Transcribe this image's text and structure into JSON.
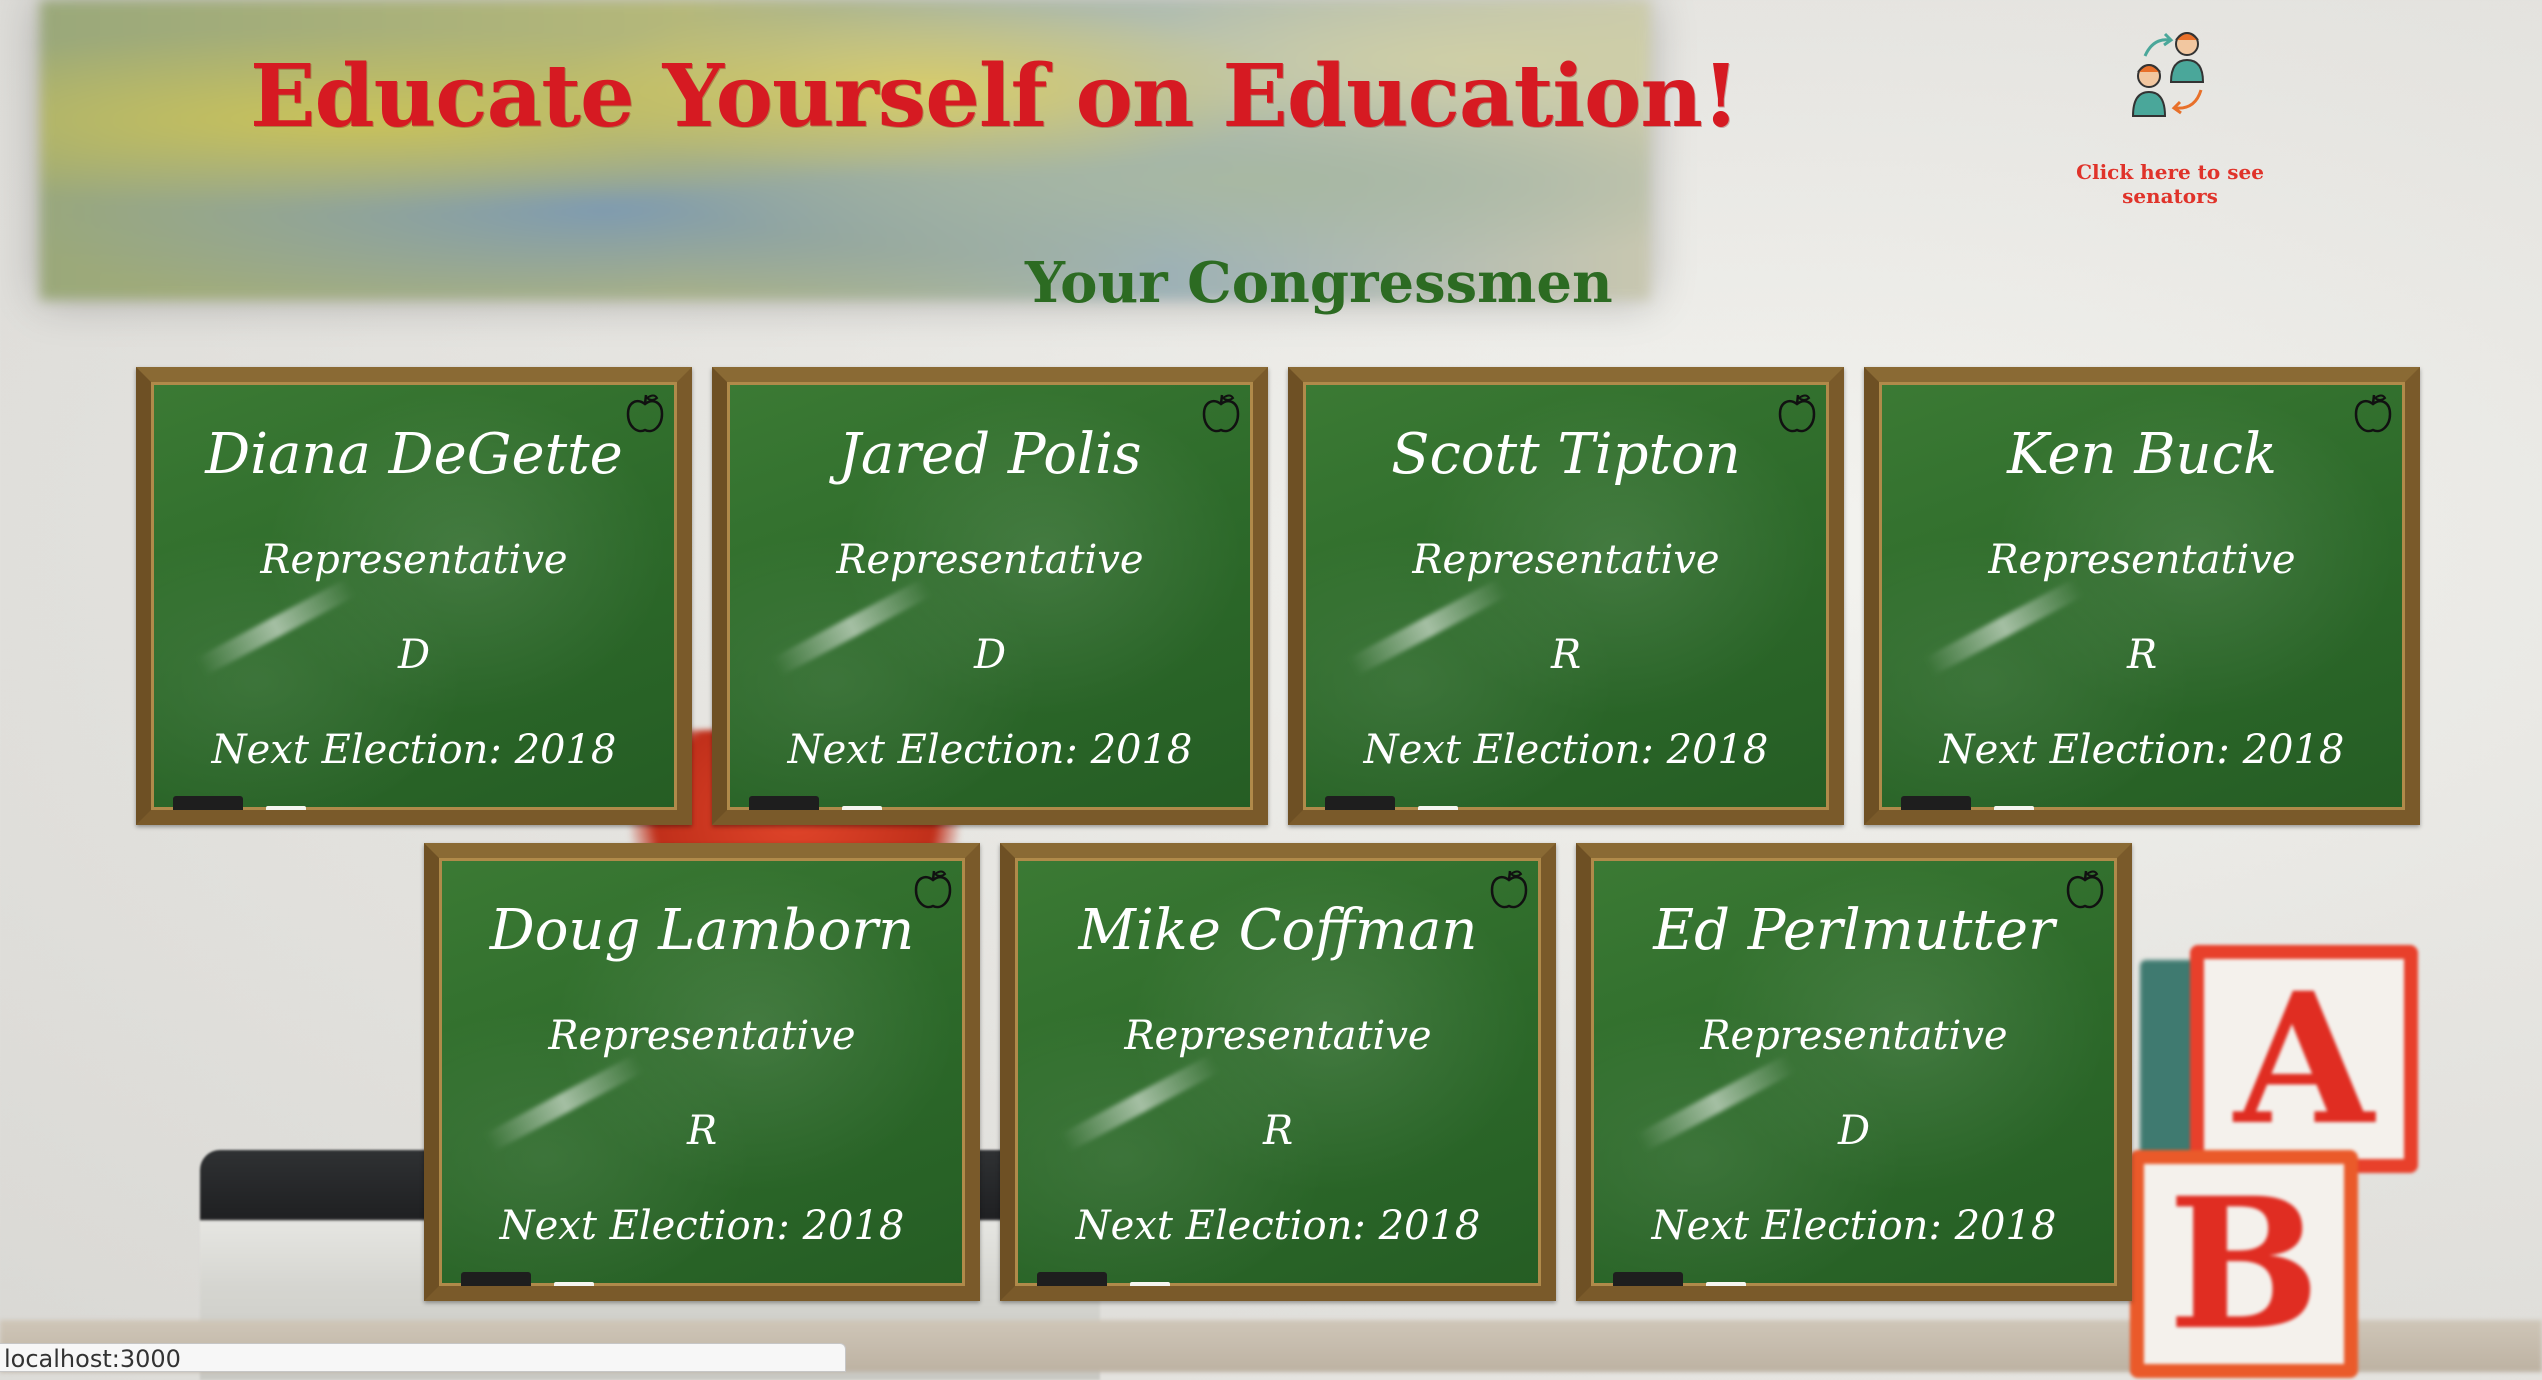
{
  "header": {
    "title": "Educate Yourself on Education!",
    "subtitle": "Your Congressmen"
  },
  "senators_link": {
    "label": "Click here to see senators",
    "icon": "people-swap-icon"
  },
  "congressmen": [
    {
      "name": "Diana DeGette",
      "role": "Representative",
      "party": "D",
      "next_election": "Next Election: 2018"
    },
    {
      "name": "Jared Polis",
      "role": "Representative",
      "party": "D",
      "next_election": "Next Election: 2018"
    },
    {
      "name": "Scott Tipton",
      "role": "Representative",
      "party": "R",
      "next_election": "Next Election: 2018"
    },
    {
      "name": "Ken Buck",
      "role": "Representative",
      "party": "R",
      "next_election": "Next Election: 2018"
    },
    {
      "name": "Doug Lamborn",
      "role": "Representative",
      "party": "R",
      "next_election": "Next Election: 2018"
    },
    {
      "name": "Mike Coffman",
      "role": "Representative",
      "party": "R",
      "next_election": "Next Election: 2018"
    },
    {
      "name": "Ed Perlmutter",
      "role": "Representative",
      "party": "D",
      "next_election": "Next Election: 2018"
    }
  ],
  "status_bar": {
    "url": "localhost:3000"
  },
  "colors": {
    "title": "#d61a22",
    "subtitle": "#2c6b22",
    "link": "#e0332a",
    "chalkboard": "#2d6a2a",
    "frame": "#7a5a2a"
  }
}
